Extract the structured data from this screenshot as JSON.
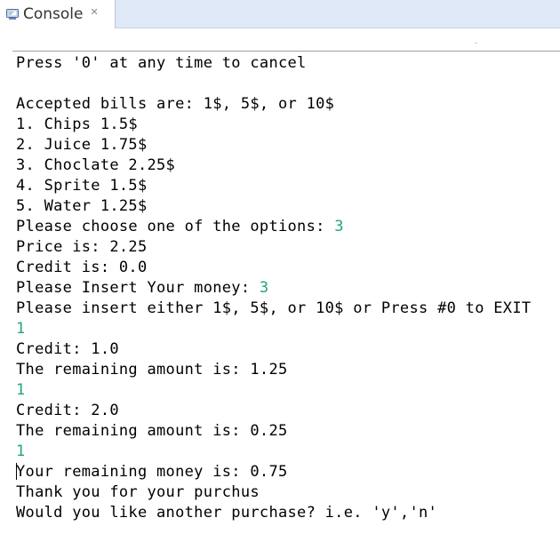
{
  "tab": {
    "title": "Console",
    "close_glyph": "✕",
    "icon": "console-icon"
  },
  "colors": {
    "tabbar_bg": "#dfe8f6",
    "stdout": "#000000",
    "stdin": "#21a67a"
  },
  "console": {
    "lines": [
      {
        "out": "Press '0' at any time to cancel",
        "in": ""
      },
      {
        "out": "",
        "in": ""
      },
      {
        "out": "Accepted bills are: 1$, 5$, or 10$",
        "in": ""
      },
      {
        "out": "1. Chips 1.5$",
        "in": ""
      },
      {
        "out": "2. Juice 1.75$",
        "in": ""
      },
      {
        "out": "3. Choclate 2.25$",
        "in": ""
      },
      {
        "out": "4. Sprite 1.5$",
        "in": ""
      },
      {
        "out": "5. Water 1.25$",
        "in": ""
      },
      {
        "out": "Please choose one of the options: ",
        "in": "3"
      },
      {
        "out": "Price is: 2.25",
        "in": ""
      },
      {
        "out": "Credit is: 0.0",
        "in": ""
      },
      {
        "out": "Please Insert Your money: ",
        "in": "3"
      },
      {
        "out": "Please insert either 1$, 5$, or 10$ or Press #0 to EXIT",
        "in": ""
      },
      {
        "out": "",
        "in": "1"
      },
      {
        "out": "Credit: 1.0",
        "in": ""
      },
      {
        "out": "The remaining amount is: 1.25",
        "in": ""
      },
      {
        "out": "",
        "in": "1"
      },
      {
        "out": "Credit: 2.0",
        "in": ""
      },
      {
        "out": "The remaining amount is: 0.25",
        "in": ""
      },
      {
        "out": "",
        "in": "1"
      },
      {
        "out": "Your remaining money is: 0.75",
        "in": ""
      },
      {
        "out": "Thank you for your purchus",
        "in": ""
      },
      {
        "out": "Would you like another purchase? i.e. 'y','n'",
        "in": ""
      }
    ]
  }
}
